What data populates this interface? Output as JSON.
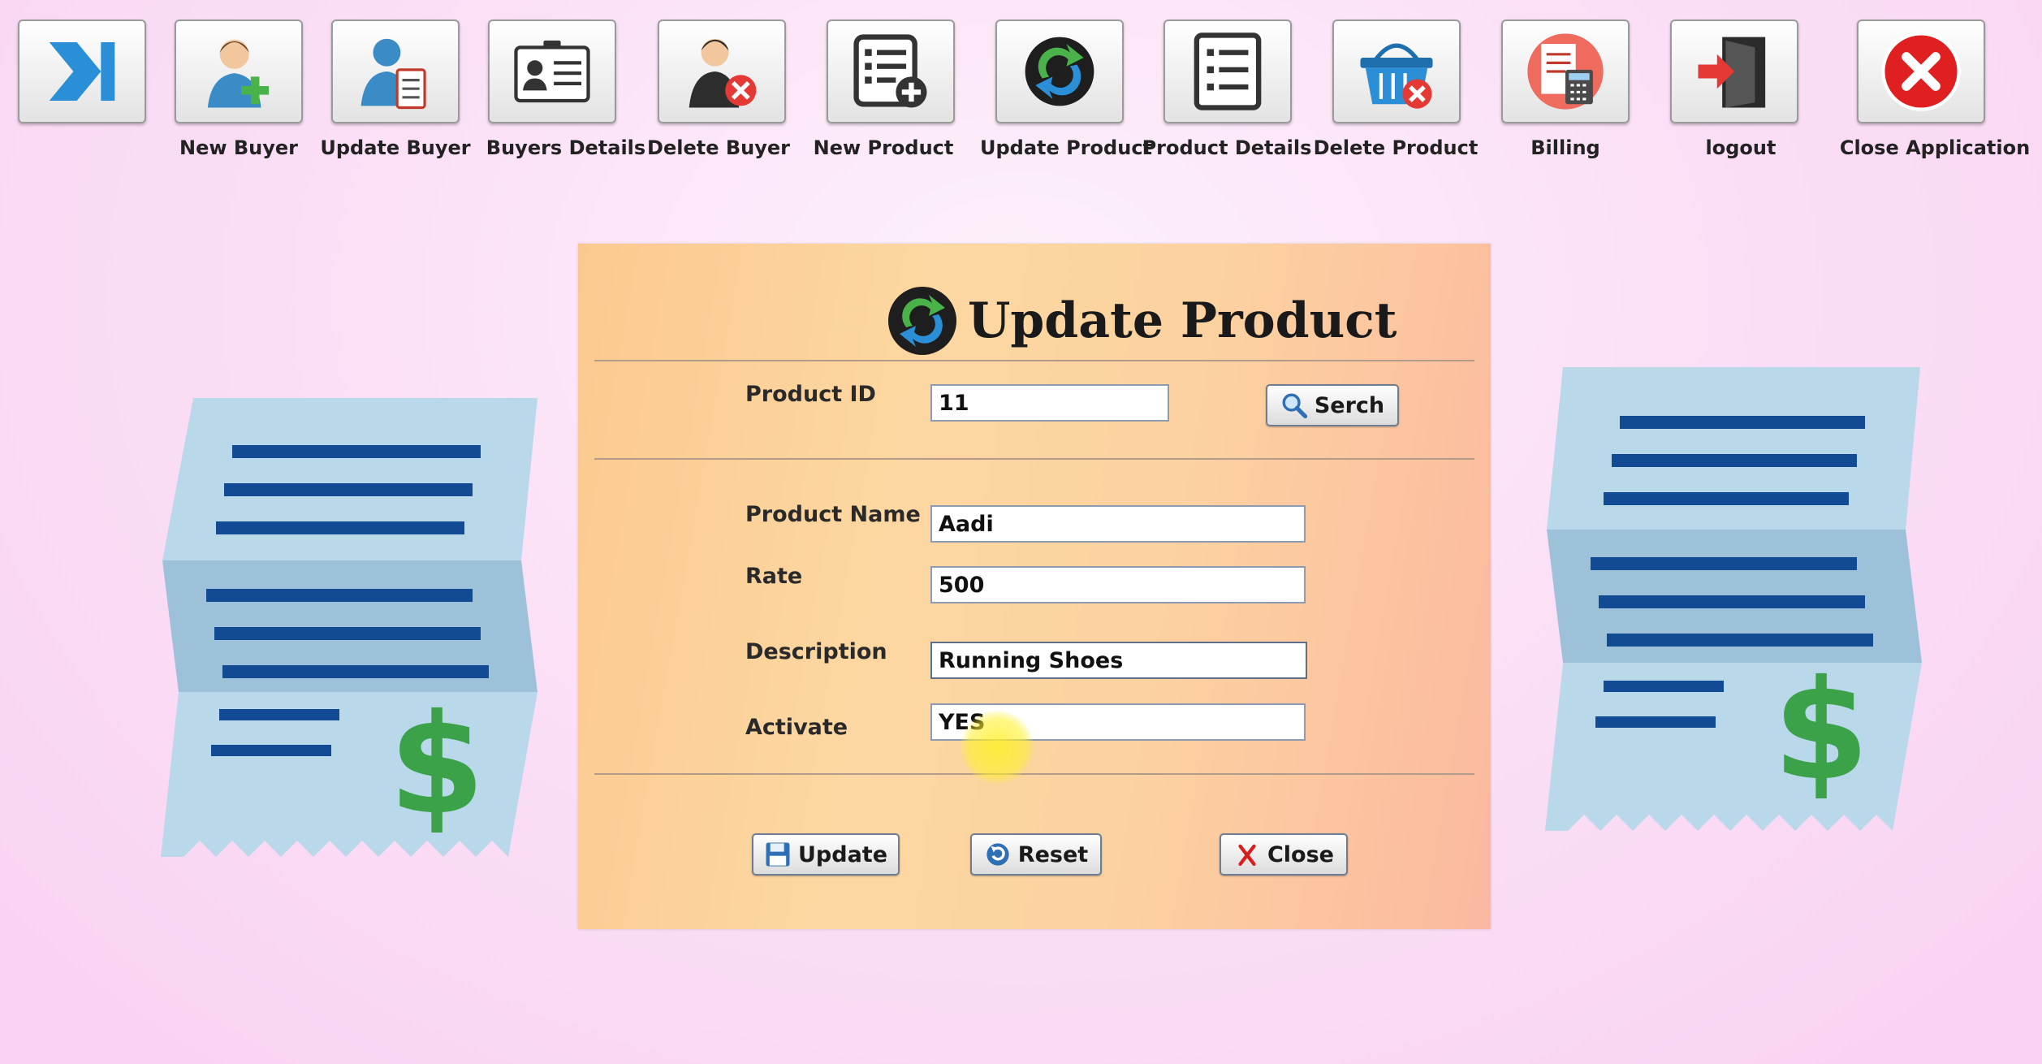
{
  "toolbar": {
    "buttons": [
      {
        "label": "",
        "icon": "next-icon"
      },
      {
        "label": "New Buyer",
        "icon": "add-user-icon"
      },
      {
        "label": "Update Buyer",
        "icon": "edit-user-icon"
      },
      {
        "label": "Buyers Details",
        "icon": "id-card-icon"
      },
      {
        "label": "Delete Buyer",
        "icon": "delete-user-icon"
      },
      {
        "label": "New Product",
        "icon": "add-list-icon"
      },
      {
        "label": "Update Product",
        "icon": "refresh-icon"
      },
      {
        "label": "Product Details",
        "icon": "list-icon"
      },
      {
        "label": "Delete Product",
        "icon": "delete-basket-icon"
      },
      {
        "label": "Billing",
        "icon": "billing-icon"
      },
      {
        "label": "logout",
        "icon": "logout-door-icon"
      },
      {
        "label": "Close Application",
        "icon": "close-circle-icon"
      }
    ]
  },
  "form": {
    "title": "Update Product",
    "product_id_label": "Product ID",
    "product_id_value": "11",
    "search_label": "Serch",
    "product_name_label": "Product Name",
    "product_name_value": "Aadi",
    "rate_label": "Rate",
    "rate_value": "500",
    "description_label": "Description",
    "description_value": "Running Shoes",
    "activate_label": "Activate",
    "activate_value": "YES",
    "update_label": "Update",
    "reset_label": "Reset",
    "close_label": "Close"
  },
  "colors": {
    "background": "#fbe0f6",
    "panel_left": "#fbc990",
    "panel_right": "#fbb99f",
    "receipt_light": "#b9d8ea",
    "receipt_dark": "#9cc1d9",
    "receipt_lines": "#134a94",
    "dollar": "#3ca24a"
  }
}
